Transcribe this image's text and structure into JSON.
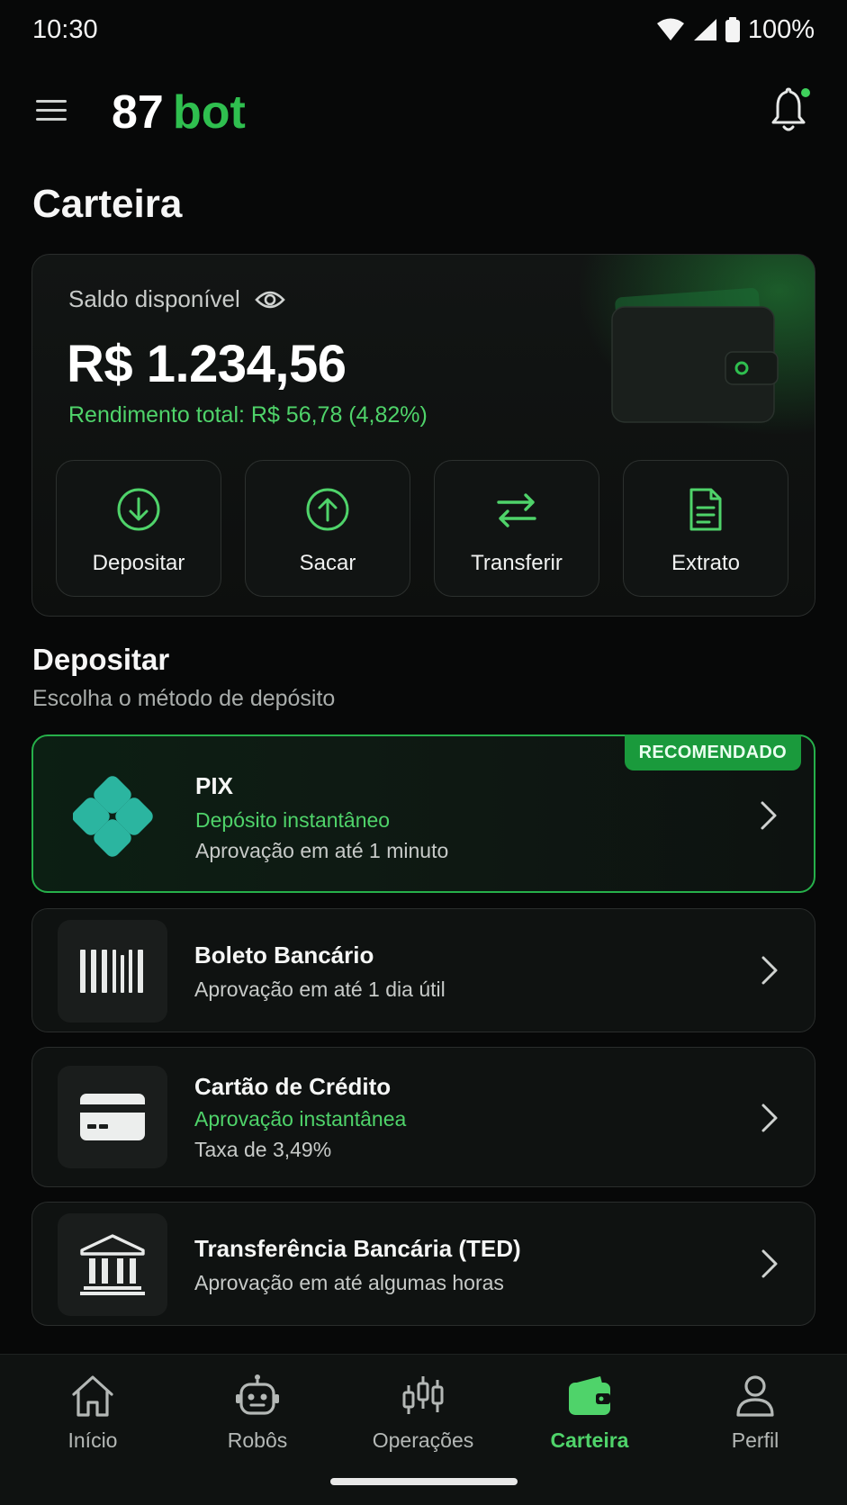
{
  "status_bar": {
    "time": "10:30",
    "battery": "100%"
  },
  "header": {
    "logo_text_1": "87",
    "logo_text_2": "bot"
  },
  "page": {
    "title": "Carteira"
  },
  "wallet": {
    "balance_label": "Saldo disponível",
    "balance_value": "R$ 1.234,56",
    "yield_text": "Rendimento total: R$ 56,78 (4,82%)",
    "actions": [
      {
        "label": "Depositar",
        "icon": "download-circle-icon"
      },
      {
        "label": "Sacar",
        "icon": "upload-circle-icon"
      },
      {
        "label": "Transferir",
        "icon": "transfer-arrows-icon"
      },
      {
        "label": "Extrato",
        "icon": "document-icon"
      }
    ]
  },
  "deposit": {
    "title": "Depositar",
    "subtitle": "Escolha o método de depósito",
    "methods": [
      {
        "title": "PIX",
        "highlight": "Depósito instantâneo",
        "desc": "Aprovação em até 1 minuto",
        "badge": "RECOMENDADO",
        "icon": "pix-icon"
      },
      {
        "title": "Boleto Bancário",
        "desc": "Aprovação em até 1 dia útil",
        "icon": "barcode-icon"
      },
      {
        "title": "Cartão de Crédito",
        "highlight": "Aprovação instantânea",
        "desc": "Taxa de 3,49%",
        "icon": "credit-card-icon"
      },
      {
        "title": "Transferência Bancária (TED)",
        "desc": "Aprovação em até algumas horas",
        "icon": "bank-icon"
      }
    ]
  },
  "nav": {
    "items": [
      {
        "label": "Início",
        "icon": "home-icon"
      },
      {
        "label": "Robôs",
        "icon": "robot-icon"
      },
      {
        "label": "Operações",
        "icon": "candlestick-icon"
      },
      {
        "label": "Carteira",
        "icon": "wallet-icon",
        "active": true
      },
      {
        "label": "Perfil",
        "icon": "user-icon"
      }
    ]
  },
  "colors": {
    "accent": "#4fd36a",
    "background": "#070808",
    "card": "#0f1211",
    "badge": "#1a9a3c"
  }
}
